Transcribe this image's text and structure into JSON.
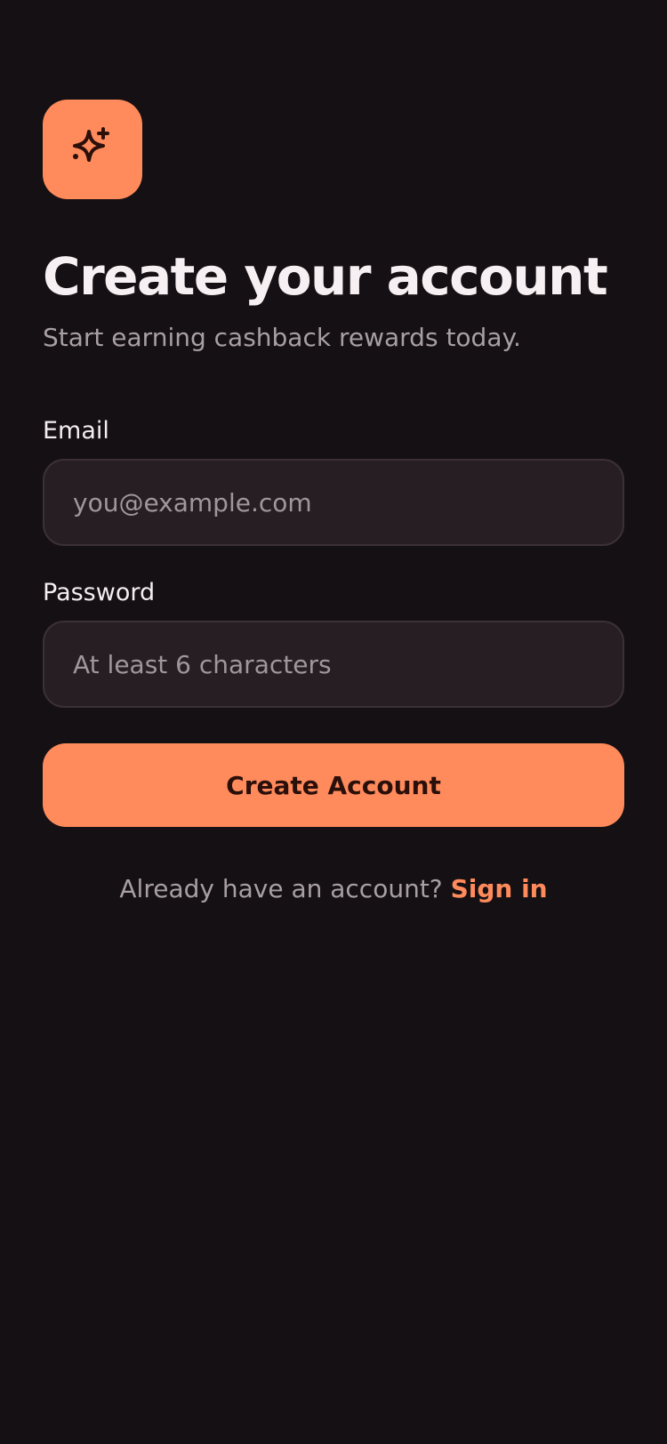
{
  "brand": {
    "logo_icon": "sparkles-icon",
    "accent_color": "#ff8a5b",
    "background_color": "#151013"
  },
  "header": {
    "title": "Create your account",
    "subtitle": "Start earning cashback rewards today."
  },
  "form": {
    "email": {
      "label": "Email",
      "placeholder": "you@example.com",
      "value": ""
    },
    "password": {
      "label": "Password",
      "placeholder": "At least 6 characters",
      "value": ""
    },
    "submit_label": "Create Account"
  },
  "footer": {
    "prompt": "Already have an account?",
    "signin_label": "Sign in"
  }
}
